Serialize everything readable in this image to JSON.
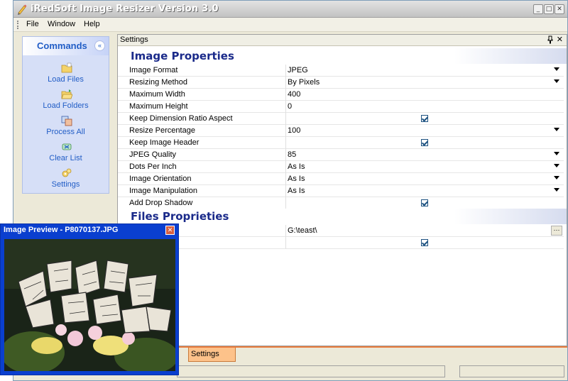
{
  "window": {
    "title": "iRedSoft Image Resizer Version 3.0",
    "minimize_glyph": "_",
    "maximize_glyph": "□",
    "close_glyph": "✕"
  },
  "menu": {
    "items": [
      {
        "label": "File"
      },
      {
        "label": "Window"
      },
      {
        "label": "Help"
      }
    ]
  },
  "commands": {
    "title": "Commands",
    "collapse_glyph": "«",
    "items": [
      {
        "label": "Load Files",
        "icon": "folder-icon"
      },
      {
        "label": "Load Folders",
        "icon": "open-folder-icon"
      },
      {
        "label": "Process All",
        "icon": "process-icon"
      },
      {
        "label": "Clear List",
        "icon": "clear-icon"
      },
      {
        "label": "Settings",
        "icon": "settings-icon"
      }
    ]
  },
  "settings": {
    "title": "Settings",
    "pin_glyph": "📌",
    "close_glyph": "✕",
    "sections": [
      {
        "title": "Image Properties",
        "rows": [
          {
            "name": "Image Format",
            "value": "JPEG",
            "control": "dropdown"
          },
          {
            "name": "Resizing Method",
            "value": "By Pixels",
            "control": "dropdown"
          },
          {
            "name": "Maximum Width",
            "value": "400",
            "control": "text"
          },
          {
            "name": "Maximum Height",
            "value": "0",
            "control": "text"
          },
          {
            "name": "Keep Dimension Ratio Aspect",
            "value": "",
            "control": "checkbox",
            "checked": true
          },
          {
            "name": "Resize Percentage",
            "value": "100",
            "control": "dropdown"
          },
          {
            "name": "Keep Image Header",
            "value": "",
            "control": "checkbox",
            "checked": true
          },
          {
            "name": "JPEG Quality",
            "value": "85",
            "control": "dropdown"
          },
          {
            "name": "Dots Per Inch",
            "value": "As Is",
            "control": "dropdown"
          },
          {
            "name": "Image Orientation",
            "value": "As Is",
            "control": "dropdown"
          },
          {
            "name": "Image Manipulation",
            "value": "As Is",
            "control": "dropdown"
          },
          {
            "name": "Add Drop Shadow",
            "value": "",
            "control": "checkbox",
            "checked": true
          }
        ]
      },
      {
        "title": "Files Proprieties",
        "rows": [
          {
            "name": "y/Folder",
            "value": "G:\\teast\\",
            "control": "browse"
          },
          {
            "name": "tory Structure",
            "value": "",
            "control": "checkbox",
            "checked": true
          }
        ]
      }
    ]
  },
  "tabs": {
    "active": "Settings"
  },
  "preview": {
    "title": "Image Preview - P8070137.JPG",
    "close_glyph": "✕",
    "image_alt": "Butterflies on flowers"
  },
  "colors": {
    "accent_blue": "#215dc6",
    "preview_border": "#0a3fcf",
    "active_tab": "#fdc28a",
    "section_title": "#1a2a8a"
  }
}
